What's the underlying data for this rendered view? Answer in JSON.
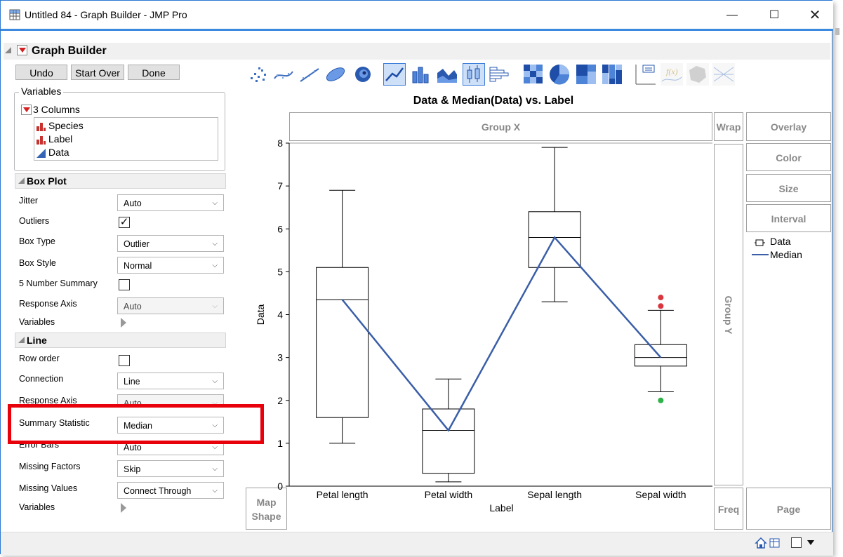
{
  "window": {
    "title": "Untitled 84 - Graph Builder - JMP Pro"
  },
  "header": {
    "title": "Graph Builder"
  },
  "buttons": {
    "undo": "Undo",
    "start_over": "Start Over",
    "done": "Done"
  },
  "variables": {
    "legend": "Variables",
    "columns_label": "3 Columns",
    "columns": [
      "Species",
      "Label",
      "Data"
    ]
  },
  "boxplot": {
    "title": "Box Plot",
    "jitter_label": "Jitter",
    "jitter_value": "Auto",
    "outliers_label": "Outliers",
    "outliers_checked": true,
    "box_type_label": "Box Type",
    "box_type_value": "Outlier",
    "box_style_label": "Box Style",
    "box_style_value": "Normal",
    "five_num_label": "5 Number Summary",
    "five_num_checked": false,
    "response_axis_label": "Response Axis",
    "response_axis_value": "Auto",
    "variables_label": "Variables"
  },
  "line": {
    "title": "Line",
    "row_order_label": "Row order",
    "row_order_checked": false,
    "connection_label": "Connection",
    "connection_value": "Line",
    "response_axis_label": "Response Axis",
    "response_axis_value": "Auto",
    "summary_stat_label": "Summary Statistic",
    "summary_stat_value": "Median",
    "error_bars_label": "Error Bars",
    "error_bars_value": "Auto",
    "missing_factors_label": "Missing Factors",
    "missing_factors_value": "Skip",
    "missing_values_label": "Missing Values",
    "missing_values_value": "Connect Through",
    "variables_label": "Variables"
  },
  "zones": {
    "group_x": "Group X",
    "group_y": "Group Y",
    "wrap": "Wrap",
    "overlay": "Overlay",
    "color": "Color",
    "size": "Size",
    "interval": "Interval",
    "map_shape": "Map Shape",
    "freq": "Freq",
    "page": "Page"
  },
  "legend_items": {
    "data": "Data",
    "median": "Median"
  },
  "colors": {
    "line": "#3a5ea8",
    "outlier_red": "#d9363e",
    "outlier_green": "#2fb24a",
    "highlight": "#e8000b"
  },
  "chart_data": {
    "type": "box",
    "title": "Data & Median(Data) vs. Label",
    "xlabel": "Label",
    "ylabel": "Data",
    "ylim": [
      0,
      8
    ],
    "yticks": [
      "0",
      "1",
      "2",
      "3",
      "4",
      "5",
      "6",
      "7",
      "8"
    ],
    "categories": [
      "Petal length",
      "Petal width",
      "Sepal length",
      "Sepal width"
    ],
    "boxes": [
      {
        "category": "Petal length",
        "min": 1.0,
        "q1": 1.6,
        "median": 4.35,
        "q3": 5.1,
        "max": 6.9,
        "outliers": []
      },
      {
        "category": "Petal width",
        "min": 0.1,
        "q1": 0.3,
        "median": 1.3,
        "q3": 1.8,
        "max": 2.5,
        "outliers": []
      },
      {
        "category": "Sepal length",
        "min": 4.3,
        "q1": 5.1,
        "median": 5.8,
        "q3": 6.4,
        "max": 7.9,
        "outliers": []
      },
      {
        "category": "Sepal width",
        "min": 2.2,
        "q1": 2.8,
        "median": 3.0,
        "q3": 3.3,
        "max": 4.1,
        "outliers": [
          4.4,
          4.2,
          2.0
        ]
      }
    ],
    "series": [
      {
        "name": "Median",
        "type": "line",
        "values": [
          4.35,
          1.3,
          5.8,
          3.0
        ]
      }
    ],
    "legend": [
      "Data",
      "Median"
    ]
  }
}
